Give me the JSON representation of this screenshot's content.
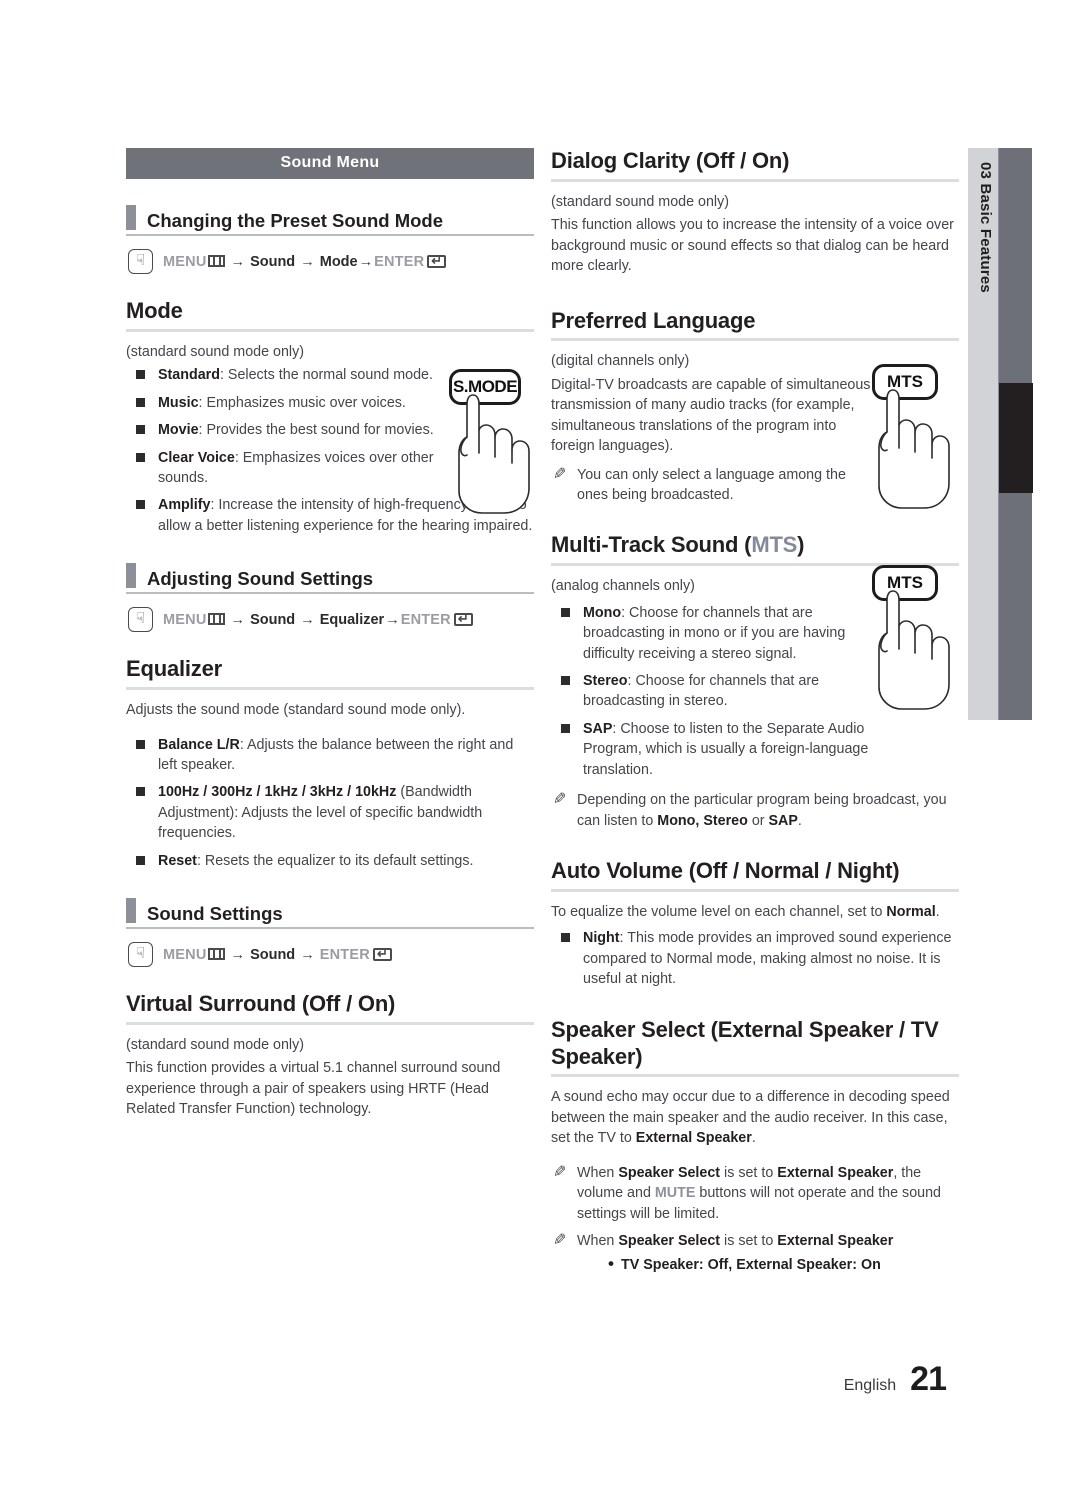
{
  "page": {
    "footer_language": "English",
    "footer_page_number": "21",
    "side_tab_chapter": "03",
    "side_tab_title": "Basic Features",
    "side_tab_combined": "03   Basic Features"
  },
  "colors": {
    "band": "#6f7278",
    "side_tab": "#d2d3d6",
    "side_bar": "#6d7079",
    "side_bar_active": "#231f20",
    "accent_blue_gray": "#858a9a",
    "rule": "#dcdde0"
  },
  "left_column": {
    "band_title": "Sound Menu",
    "sections": [
      {
        "heading": "Changing the Preset Sound Mode",
        "path": {
          "menu": "MENU",
          "arrow1": "→",
          "item1": "Sound",
          "arrow2": "→",
          "item2": "Mode",
          "arrow3": "→",
          "enter": "ENTER"
        },
        "topic": "Mode",
        "note_line": "(standard sound mode only)",
        "bullets": [
          {
            "term": "Standard",
            "text": ": Selects the normal sound mode."
          },
          {
            "term": "Music",
            "text": ": Emphasizes music over voices."
          },
          {
            "term": "Movie",
            "text": ": Provides the best sound for movies."
          },
          {
            "term": "Clear Voice",
            "text": ": Emphasizes voices over other sounds."
          },
          {
            "term": "Amplify",
            "text": ": Increase the intensity of high-frequency sound to allow a better listening experience for the hearing impaired."
          }
        ]
      },
      {
        "heading": "Adjusting Sound Settings",
        "path": {
          "menu": "MENU",
          "arrow1": "→",
          "item1": "Sound",
          "arrow2": "→",
          "item2": "Equalizer",
          "arrow3": "→",
          "enter": "ENTER"
        },
        "topic": "Equalizer",
        "intro": "Adjusts the sound mode (standard sound mode only).",
        "bullets": [
          {
            "term": "Balance L/R",
            "text": ": Adjusts the balance between the right and left speaker."
          },
          {
            "term": "100Hz / 300Hz / 1kHz / 3kHz / 10kHz",
            "text": " (Bandwidth Adjustment): Adjusts the level of specific bandwidth frequencies."
          },
          {
            "term": "Reset",
            "text": ": Resets the equalizer to its default settings."
          }
        ]
      },
      {
        "heading": "Sound Settings",
        "path": {
          "menu": "MENU",
          "arrow1": "→",
          "item1": "Sound",
          "arrow2": "→",
          "enter": "ENTER"
        },
        "topic": "Virtual Surround (Off / On)",
        "note_line": "(standard sound mode only)",
        "paragraph": "This function provides a virtual 5.1 channel surround sound experience through a pair of speakers using HRTF (Head Related Transfer Function) technology."
      }
    ],
    "remote_button": "S.MODE"
  },
  "right_column": {
    "sections": [
      {
        "topic": "Dialog Clarity (Off / On)",
        "note_line": "(standard sound mode only)",
        "paragraph": "This function allows you to increase the intensity of a voice over background music or sound effects so that dialog can be heard more clearly."
      },
      {
        "topic": "Preferred Language",
        "note_line": "(digital channels only)",
        "paragraph": "Digital-TV broadcasts are capable of simultaneous transmission of many audio tracks (for example, simultaneous translations of the program into foreign languages).",
        "notes": [
          "You can only select a language among the ones being broadcasted."
        ],
        "remote_button": "MTS"
      },
      {
        "topic_prefix": "Multi-Track Sound (",
        "topic_accent": "MTS",
        "topic_suffix": ")",
        "note_line": "(analog channels only)",
        "bullets": [
          {
            "term": "Mono",
            "text": ": Choose for channels that are broadcasting in mono or if you are having difficulty receiving a stereo signal."
          },
          {
            "term": "Stereo",
            "text": ": Choose for channels that are broadcasting in stereo."
          },
          {
            "term": "SAP",
            "text": ": Choose to listen to the Separate Audio Program, which is usually a foreign-language translation."
          }
        ],
        "note_parts": {
          "a": "Depending on the particular program being broadcast, you can listen to ",
          "b": "Mono, Stereo",
          "c": " or ",
          "d": "SAP",
          "e": "."
        },
        "remote_button": "MTS"
      },
      {
        "topic": "Auto Volume (Off / Normal / Night)",
        "intro_parts": {
          "a": "To equalize the volume level on each channel, set to ",
          "b": "Normal",
          "c": "."
        },
        "bullets": [
          {
            "term": "Night",
            "text": ": This mode provides an improved sound experience compared to Normal mode, making almost no noise. It is useful at night."
          }
        ]
      },
      {
        "topic": "Speaker Select (External Speaker / TV Speaker)",
        "paragraph_parts": {
          "a": "A sound echo may occur due to a difference in decoding speed between the main speaker and the audio receiver. In this case, set the TV to ",
          "b": "External Speaker",
          "c": "."
        },
        "note1_parts": {
          "a": "When ",
          "b": "Speaker Select",
          "c": " is set to ",
          "d": "External Speaker",
          "e": ", the volume and ",
          "f": "MUTE",
          "g": " buttons will not operate and the sound settings will be limited."
        },
        "note2_parts": {
          "a": "When ",
          "b": "Speaker Select",
          "c": " is set to ",
          "d": "External Speaker"
        },
        "sub_bullets": [
          "TV Speaker: Off, External Speaker: On"
        ]
      }
    ]
  }
}
